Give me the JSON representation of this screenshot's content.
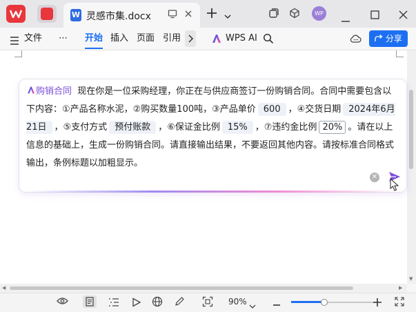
{
  "titlebar": {
    "doc_tab_title": "灵感市集.docx",
    "avatar_text": "WP",
    "icons": [
      "wps-logo-icon",
      "pdf-icon",
      "word-doc-icon",
      "monitor-icon",
      "close-icon",
      "add-tab-icon",
      "chevron-down-icon",
      "window-switch-icon",
      "cube-icon",
      "minimize-icon",
      "maximize-icon",
      "close-window-icon"
    ]
  },
  "toolbar": {
    "file_label": "文件",
    "more_label": "⋯",
    "tabs": [
      "开始",
      "插入",
      "页面",
      "引用"
    ],
    "ai_label": "WPS AI",
    "share_label": "分享"
  },
  "ai_card": {
    "tag": "购销合同",
    "seg1": "现在你是一位采购经理，你正在与供应商签订一份购销合同。合同中需要包含以下内容：①产品名称水泥，②购买数量100吨，③产品单价",
    "chip_price": "600",
    "seg2": "，④交货日期",
    "chip_date": "2024年6月21日",
    "seg3": "，⑤支付方式",
    "chip_payment": "预付账款",
    "seg4": "，⑥保证金比例",
    "chip_deposit": "15%",
    "seg5": "，⑦违约金比例",
    "chip_penalty": "20%",
    "seg6": "。请在以上信息的基础上，生成一份购销合同。请直接输出结果，不要返回其他内容。请按标准合同格式输出，条例标题以加粗显示。"
  },
  "statusbar": {
    "zoom": "90%",
    "zoom_level": 0.37
  },
  "colors": {
    "accent": "#1d6ff2",
    "ai_purple": "#7b4fd8"
  }
}
